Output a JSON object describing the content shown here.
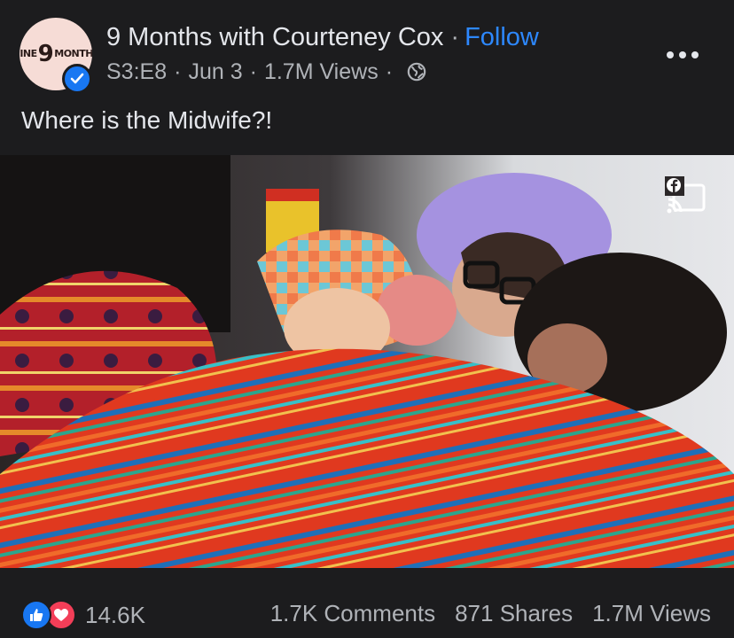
{
  "post": {
    "page_name": "9 Months with Courteney Cox",
    "separator": "·",
    "follow_label": "Follow",
    "episode": "S3:E8",
    "date": "Jun 3",
    "views_meta": "1.7M Views",
    "caption": "Where is the Midwife?!",
    "avatar_logo": {
      "left": "NINE",
      "middle": "9",
      "right": "MONTHS"
    }
  },
  "video": {
    "cast_icon": "cast-to-device-icon"
  },
  "footer": {
    "reaction_icons": [
      "like-icon",
      "love-icon"
    ],
    "reaction_count": "14.6K",
    "comments": "1.7K Comments",
    "shares": "871 Shares",
    "views": "1.7M Views"
  },
  "colors": {
    "background": "#1c1c1e",
    "link_blue": "#2d88ff",
    "verified_blue": "#1877f2",
    "love_red": "#f33e58",
    "secondary_text": "#b0b3b8"
  }
}
